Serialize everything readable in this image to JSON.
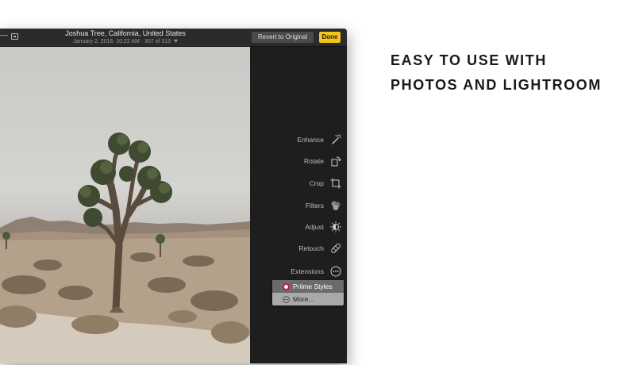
{
  "titlebar": {
    "title": "Joshua Tree, California, United States",
    "subtitle": "January 2, 2016, 10:22 AM · 307 of 319",
    "revert_label": "Revert to Original",
    "done_label": "Done"
  },
  "sidebar": {
    "tools": [
      {
        "label": "Enhance",
        "icon": "magic-wand-icon"
      },
      {
        "label": "Rotate",
        "icon": "rotate-icon"
      },
      {
        "label": "Crop",
        "icon": "crop-icon"
      },
      {
        "label": "Filters",
        "icon": "filters-icon"
      },
      {
        "label": "Adjust",
        "icon": "adjust-icon"
      },
      {
        "label": "Retouch",
        "icon": "bandage-icon"
      },
      {
        "label": "Extensions",
        "icon": "ellipsis-circle-icon"
      }
    ]
  },
  "extensions_menu": {
    "items": [
      {
        "label": "Priime Styles",
        "selected": true
      },
      {
        "label": "More..."
      }
    ]
  },
  "headline": {
    "line1": "EASY TO USE WITH",
    "line2": "PHOTOS AND LIGHTROOM"
  },
  "colors": {
    "done_button": "#f5c518",
    "window_background": "#1f1f1f"
  }
}
